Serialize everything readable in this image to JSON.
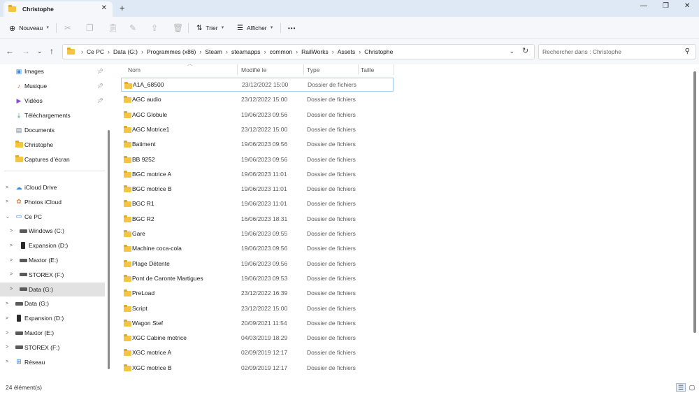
{
  "window": {
    "tab_title": "Christophe",
    "tab_close": "✕",
    "new_tab": "+",
    "minimize": "—",
    "maximize": "❐",
    "close": "✕"
  },
  "toolbar": {
    "new_label": "Nouveau",
    "sort_label": "Trier",
    "view_label": "Afficher",
    "more_label": "•••"
  },
  "nav": {
    "breadcrumb": [
      "Ce PC",
      "Data (G:)",
      "Programmes (x86)",
      "Steam",
      "steamapps",
      "common",
      "RailWorks",
      "Assets",
      "Christophe"
    ],
    "search_placeholder": "Rechercher dans : Christophe"
  },
  "sidebar": {
    "quick_access": [
      {
        "label": "Images",
        "icon": "images-icon",
        "pinned": true
      },
      {
        "label": "Musique",
        "icon": "music-icon",
        "pinned": true
      },
      {
        "label": "Vidéos",
        "icon": "videos-icon",
        "pinned": true
      },
      {
        "label": "Téléchargements",
        "icon": "download-icon",
        "pinned": false
      },
      {
        "label": "Documents",
        "icon": "documents-icon",
        "pinned": false
      },
      {
        "label": "Christophe",
        "icon": "folder-icon",
        "pinned": false
      },
      {
        "label": "Captures d’écran",
        "icon": "folder-icon",
        "pinned": false
      }
    ],
    "tree": [
      {
        "label": "iCloud Drive",
        "icon": "icloud-icon",
        "indent": 0,
        "expand": ">"
      },
      {
        "label": "Photos iCloud",
        "icon": "photos-icon",
        "indent": 0,
        "expand": ">"
      },
      {
        "label": "Ce PC",
        "icon": "pc-icon",
        "indent": 0,
        "expand": "⌄"
      },
      {
        "label": "Windows (C:)",
        "icon": "windows-drive-icon",
        "indent": 1,
        "expand": ">"
      },
      {
        "label": "Expansion (D:)",
        "icon": "phone-drive-icon",
        "indent": 1,
        "expand": ">"
      },
      {
        "label": "Maxtor (E:)",
        "icon": "drive-icon",
        "indent": 1,
        "expand": ">"
      },
      {
        "label": "STOREX (F:)",
        "icon": "drive-icon",
        "indent": 1,
        "expand": ">"
      },
      {
        "label": "Data (G:)",
        "icon": "drive-icon",
        "indent": 1,
        "expand": ">",
        "selected": true
      },
      {
        "label": "Data (G:)",
        "icon": "drive-icon",
        "indent": 0,
        "expand": ">"
      },
      {
        "label": "Expansion (D:)",
        "icon": "phone-drive-icon",
        "indent": 0,
        "expand": ">"
      },
      {
        "label": "Maxtor (E:)",
        "icon": "drive-icon",
        "indent": 0,
        "expand": ">"
      },
      {
        "label": "STOREX (F:)",
        "icon": "drive-icon",
        "indent": 0,
        "expand": ">"
      },
      {
        "label": "Réseau",
        "icon": "network-icon",
        "indent": 0,
        "expand": ">"
      }
    ]
  },
  "columns": {
    "name": "Nom",
    "modified": "Modifié le",
    "type": "Type",
    "size": "Taille"
  },
  "files": [
    {
      "name": "A1A_68500",
      "date": "23/12/2022 15:00",
      "type": "Dossier de fichiers"
    },
    {
      "name": "AGC audio",
      "date": "23/12/2022 15:00",
      "type": "Dossier de fichiers"
    },
    {
      "name": "AGC Globule",
      "date": "19/06/2023 09:56",
      "type": "Dossier de fichiers"
    },
    {
      "name": "AGC Motrice1",
      "date": "23/12/2022 15:00",
      "type": "Dossier de fichiers"
    },
    {
      "name": "Batiment",
      "date": "19/06/2023 09:56",
      "type": "Dossier de fichiers"
    },
    {
      "name": "BB 9252",
      "date": "19/06/2023 09:56",
      "type": "Dossier de fichiers"
    },
    {
      "name": "BGC motrice A",
      "date": "19/06/2023 11:01",
      "type": "Dossier de fichiers"
    },
    {
      "name": "BGC motrice B",
      "date": "19/06/2023 11:01",
      "type": "Dossier de fichiers"
    },
    {
      "name": "BGC R1",
      "date": "19/06/2023 11:01",
      "type": "Dossier de fichiers"
    },
    {
      "name": "BGC R2",
      "date": "16/06/2023 18:31",
      "type": "Dossier de fichiers"
    },
    {
      "name": "Gare",
      "date": "19/06/2023 09:55",
      "type": "Dossier de fichiers"
    },
    {
      "name": "Machine coca-cola",
      "date": "19/06/2023 09:56",
      "type": "Dossier de fichiers"
    },
    {
      "name": "Plage Détente",
      "date": "19/06/2023 09:56",
      "type": "Dossier de fichiers"
    },
    {
      "name": "Pont de Caronte Martigues",
      "date": "19/06/2023 09:53",
      "type": "Dossier de fichiers"
    },
    {
      "name": "PreLoad",
      "date": "23/12/2022 16:39",
      "type": "Dossier de fichiers"
    },
    {
      "name": "Script",
      "date": "23/12/2022 15:00",
      "type": "Dossier de fichiers"
    },
    {
      "name": "Wagon Stef",
      "date": "20/09/2021 11:54",
      "type": "Dossier de fichiers"
    },
    {
      "name": "XGC Cabine motrice",
      "date": "04/03/2019 18:29",
      "type": "Dossier de fichiers"
    },
    {
      "name": "XGC motrice A",
      "date": "02/09/2019 12:17",
      "type": "Dossier de fichiers"
    },
    {
      "name": "XGC motrice B",
      "date": "02/09/2019 12:17",
      "type": "Dossier de fichiers"
    }
  ],
  "status": {
    "count": "24 élément(s)"
  },
  "colors": {
    "accent": "#0067c0",
    "folder": "#f4c542",
    "selection_border": "#a8c8ea"
  }
}
